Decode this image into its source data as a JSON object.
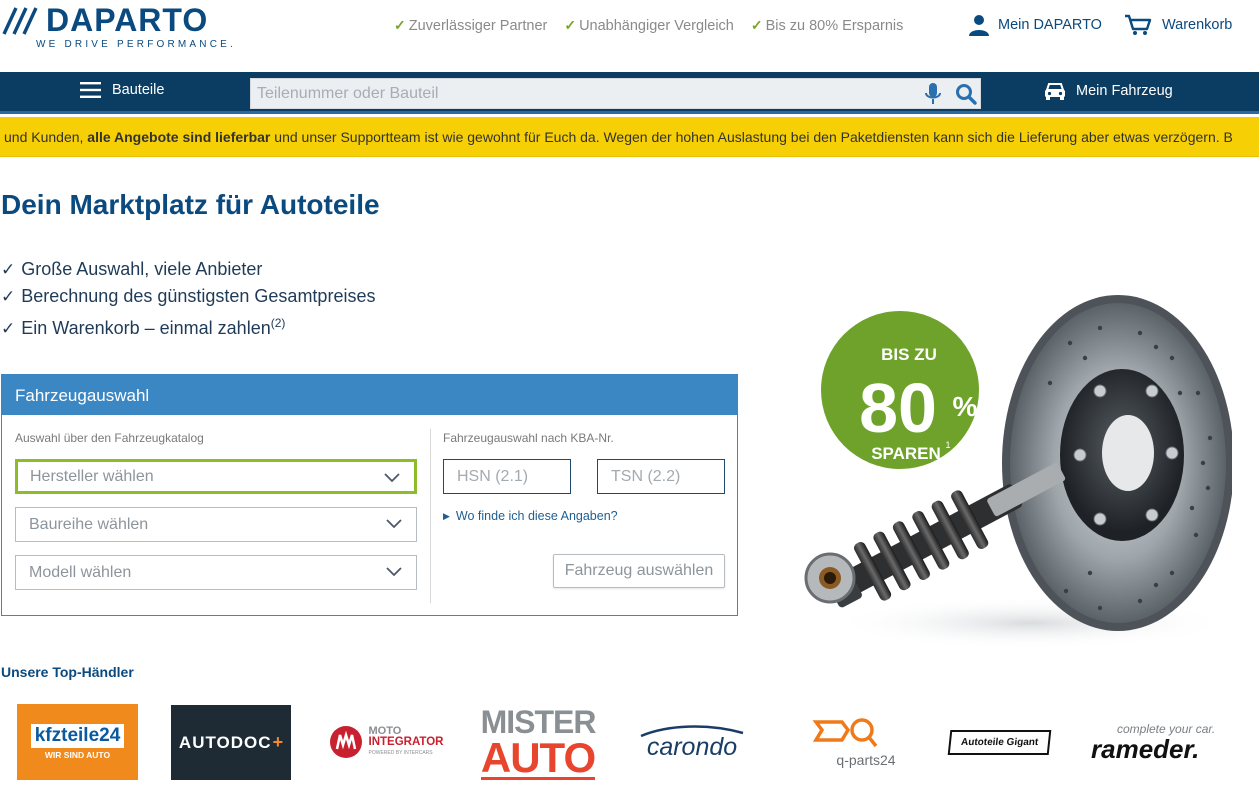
{
  "header": {
    "logo_text": "DAPARTO",
    "logo_tagline": "WE DRIVE PERFORMANCE.",
    "usps": [
      "Zuverlässiger Partner",
      "Unabhängiger Vergleich",
      "Bis zu 80% Ersparnis"
    ],
    "account_label": "Mein DAPARTO",
    "cart_label": "Warenkorb"
  },
  "nav": {
    "menu_label": "Bauteile",
    "search_placeholder": "Teilenummer oder Bauteil",
    "vehicle_label": "Mein Fahrzeug"
  },
  "banner": {
    "text_before": "und Kunden, ",
    "text_bold": "alle Angebote sind lieferbar",
    "text_after": " und unser Supportteam ist wie gewohnt für Euch da. Wegen der hohen Auslastung bei den Paketdiensten kann sich die Lieferung aber etwas verzögern. B"
  },
  "hero": {
    "title": "Dein Marktplatz für Autoteile",
    "benefits": [
      "Große Auswahl, viele Anbieter",
      "Berechnung des günstigsten Gesamtpreises",
      "Ein Warenkorb – einmal zahlen"
    ],
    "benefit_footnote": "(2)"
  },
  "vehicle_panel": {
    "title": "Fahrzeugauswahl",
    "catalog_label": "Auswahl über den Fahrzeugkatalog",
    "manufacturer_placeholder": "Hersteller wählen",
    "series_placeholder": "Baureihe wählen",
    "model_placeholder": "Modell wählen",
    "kba_label": "Fahrzeugauswahl nach KBA-Nr.",
    "hsn_placeholder": "HSN (2.1)",
    "tsn_placeholder": "TSN (2.2)",
    "help_link": "Wo finde ich diese Angaben?",
    "submit_label": "Fahrzeug auswählen"
  },
  "promo": {
    "line1": "BIS ZU",
    "big": "80",
    "percent": "%",
    "line2": "SPAREN",
    "footnote": "1",
    "badge_color": "#6ea22a"
  },
  "dealers": {
    "title": "Unsere Top-Händler",
    "kfzteile24": {
      "name": "kfzteile24",
      "sub": "WIR SIND AUTO"
    },
    "autodoc": {
      "name": "AUTODOC"
    },
    "motointegrator": {
      "line1": "MOTO",
      "line2": "INTEGRATOR",
      "line3": "POWERED BY INTERCARS"
    },
    "misterauto": {
      "line1": "MISTER",
      "line2": "AUTO"
    },
    "carondo": {
      "name": "carondo"
    },
    "qparts24": {
      "name": "q-parts24"
    },
    "autoteilegigant": {
      "name": "Autoteile Gigant"
    },
    "rameder": {
      "tagline": "complete your car.",
      "name": "rameder."
    }
  },
  "colors": {
    "brand_blue": "#0a4a7f",
    "nav_blue": "#0b3d63",
    "panel_blue": "#3b87c4",
    "banner_yellow": "#f7cf05",
    "check_green": "#7ba428"
  }
}
